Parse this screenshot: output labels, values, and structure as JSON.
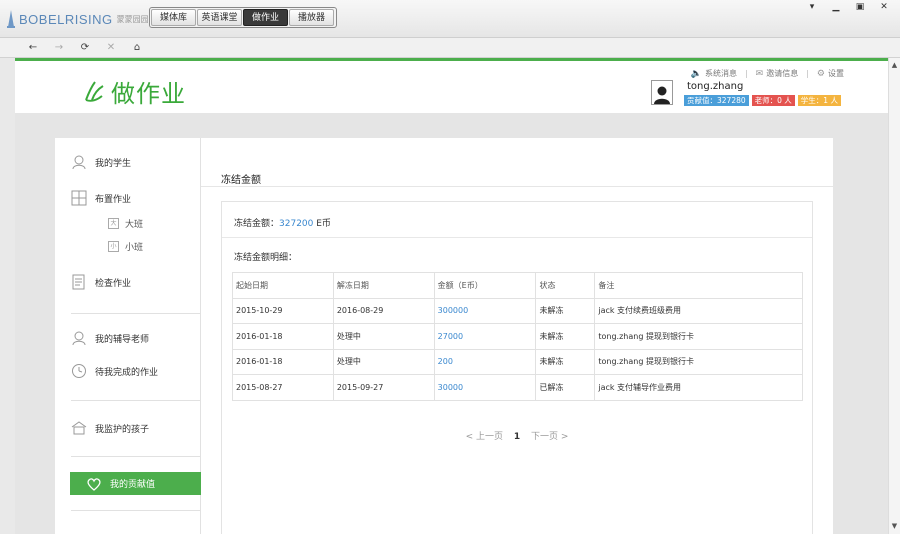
{
  "app": {
    "logo_text": "BOBELRISING",
    "logo_sub": "蒙蒙园园  拼音！",
    "tabs": [
      "媒体库",
      "英语课堂",
      "做作业",
      "播放器"
    ],
    "active_tab": 2
  },
  "nav": {
    "back_label": "←",
    "forward_label": "→",
    "refresh_label": "⟳",
    "stop_label": "✕",
    "home_label": "⌂"
  },
  "header": {
    "title": "做作业",
    "links": {
      "system_msg": "系统消息",
      "messages": "邀请信息",
      "settings": "设置"
    },
    "user": {
      "name": "tong.zhang",
      "contribution": "贡献值：327280",
      "teachers": "老师：0 人",
      "students": "学生：1 人"
    }
  },
  "sidebar": {
    "items": {
      "my_students": "我的学生",
      "assign": "布置作业",
      "big_class": "大班",
      "small_class": "小班",
      "check": "检查作业",
      "tutors": "我的辅导老师",
      "todo": "待我完成的作业",
      "kids": "我监护的孩子",
      "contribution": "我的贡献值"
    },
    "box_glyph_big": "大",
    "box_glyph_small": "小"
  },
  "main": {
    "title": "冻结金额",
    "frozen_label": "冻结金额：",
    "frozen_amount": "327200",
    "frozen_unit": " E币",
    "detail_label": "冻结金额明细：",
    "table": {
      "headers": [
        "起始日期",
        "解冻日期",
        "金额（E币）",
        "状态",
        "备注"
      ],
      "rows": [
        [
          "2015-10-29",
          "2016-08-29",
          "300000",
          "未解冻",
          "jack 支付续费班级费用"
        ],
        [
          "2016-01-18",
          "处理中",
          "27000",
          "未解冻",
          "tong.zhang 提现到银行卡"
        ],
        [
          "2016-01-18",
          "处理中",
          "200",
          "未解冻",
          "tong.zhang 提现到银行卡"
        ],
        [
          "2015-08-27",
          "2015-09-27",
          "30000",
          "已解冻",
          "jack 支付辅导作业费用"
        ]
      ]
    },
    "pager": {
      "prev": "< 上一页",
      "current": "1",
      "next": "下一页 >"
    }
  },
  "colors": {
    "brand_green": "#4cae4c",
    "link_blue": "#3a88cf",
    "badge_blue": "#4a9ed9",
    "badge_red": "#e4534f",
    "badge_orange": "#f4b43f"
  }
}
